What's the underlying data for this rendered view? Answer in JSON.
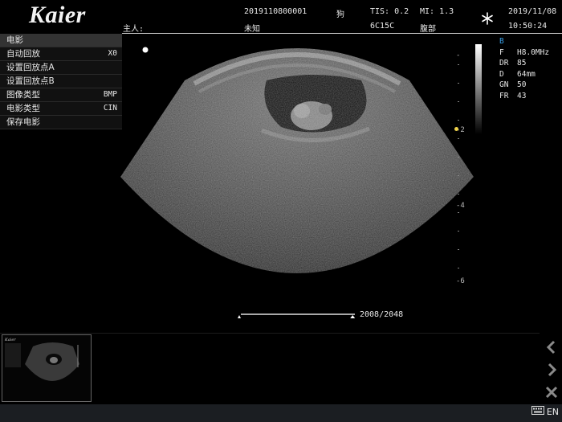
{
  "brand": {
    "logo": "Kaier"
  },
  "header": {
    "owner_label": "主人:",
    "patient_id": "2019110800001",
    "owner_value": "未知",
    "species": "狗",
    "tis": "TIS: 0.2",
    "mi": "MI: 1.3",
    "probe": "6C15C",
    "exam": "腹部",
    "date": "2019/11/08",
    "time": "10:50:24",
    "freeze_icon": "snowflake-icon"
  },
  "cine_menu": {
    "title": "电影",
    "items": [
      {
        "label": "自动回放",
        "value": "X0"
      },
      {
        "label": "设置回放点A",
        "value": ""
      },
      {
        "label": "设置回放点B",
        "value": ""
      },
      {
        "label": "图像类型",
        "value": "BMP"
      },
      {
        "label": "电影类型",
        "value": "CIN"
      },
      {
        "label": "保存电影",
        "value": ""
      }
    ]
  },
  "params": {
    "mode": "B",
    "rows": [
      {
        "key": "F",
        "value": "H8.0MHz"
      },
      {
        "key": "DR",
        "value": "85"
      },
      {
        "key": "D",
        "value": "64mm"
      },
      {
        "key": "GN",
        "value": "50"
      },
      {
        "key": "FR",
        "value": "43"
      }
    ]
  },
  "depth_scale": {
    "labels": [
      "-",
      "-2",
      "-4",
      "-6"
    ]
  },
  "cine": {
    "current_frame": 2008,
    "total_frames": 2048,
    "counter_text": "2008/2048"
  },
  "sidebar": {
    "prev_icon": "chevron-left-icon",
    "next_icon": "chevron-right-icon",
    "delete_icon": "close-icon"
  },
  "status": {
    "language": "EN",
    "keyboard_icon": "keyboard-icon"
  },
  "colors": {
    "mode_label": "#3aa0e8",
    "focus_marker": "#f0d34a"
  }
}
